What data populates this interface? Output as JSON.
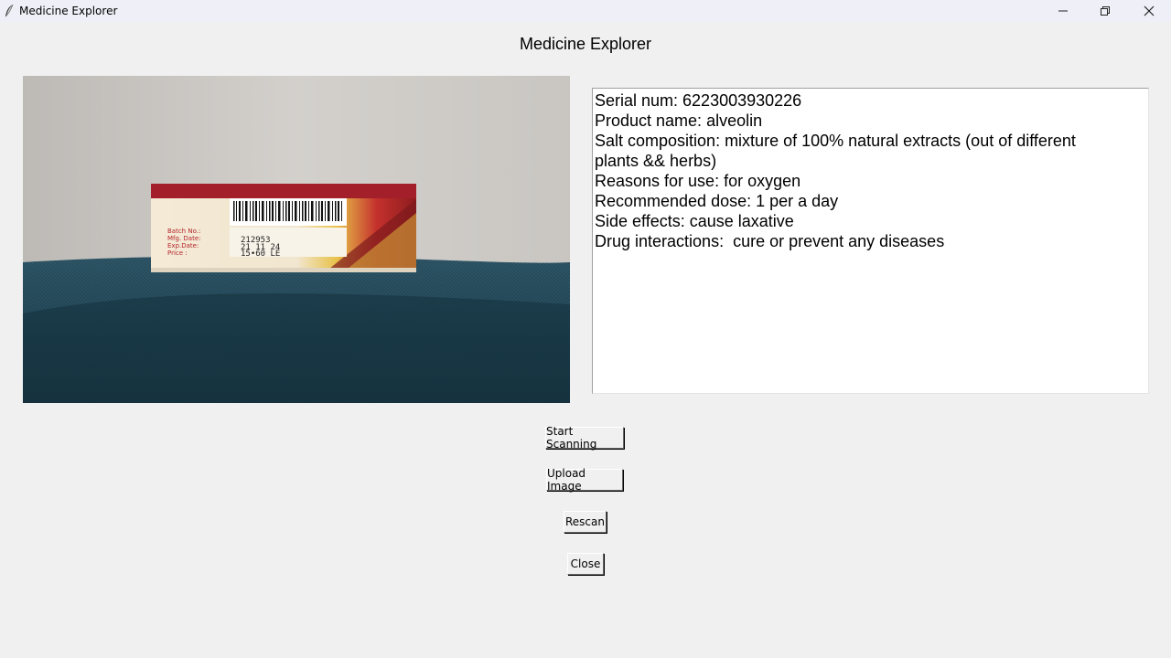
{
  "window": {
    "title": "Medicine Explorer"
  },
  "app": {
    "heading": "Medicine Explorer"
  },
  "photo": {
    "label_text": {
      "batch": "Batch No.:",
      "mfg": "Mfg. Date:",
      "exp": "Exp.Date:",
      "price": "Price :",
      "batch_value": "212953",
      "exp_value": "21 11 24",
      "price_value": "15•60 LE"
    }
  },
  "info": {
    "lines": [
      "Serial num: 6223003930226",
      "Product name: alveolin",
      "Salt composition: mixture of 100% natural extracts (out of different",
      "plants && herbs)",
      "Reasons for use: for oxygen",
      "Recommended dose: 1 per a day",
      "Side effects: cause laxative",
      "Drug interactions:  cure or prevent any diseases"
    ]
  },
  "buttons": {
    "start_scanning": "Start Scanning",
    "upload_image": "Upload Image",
    "rescan": "Rescan",
    "close": "Close"
  },
  "icons": {
    "app": "feather-icon",
    "minimize": "minimize-icon",
    "maximize": "restore-icon",
    "close": "close-icon"
  }
}
